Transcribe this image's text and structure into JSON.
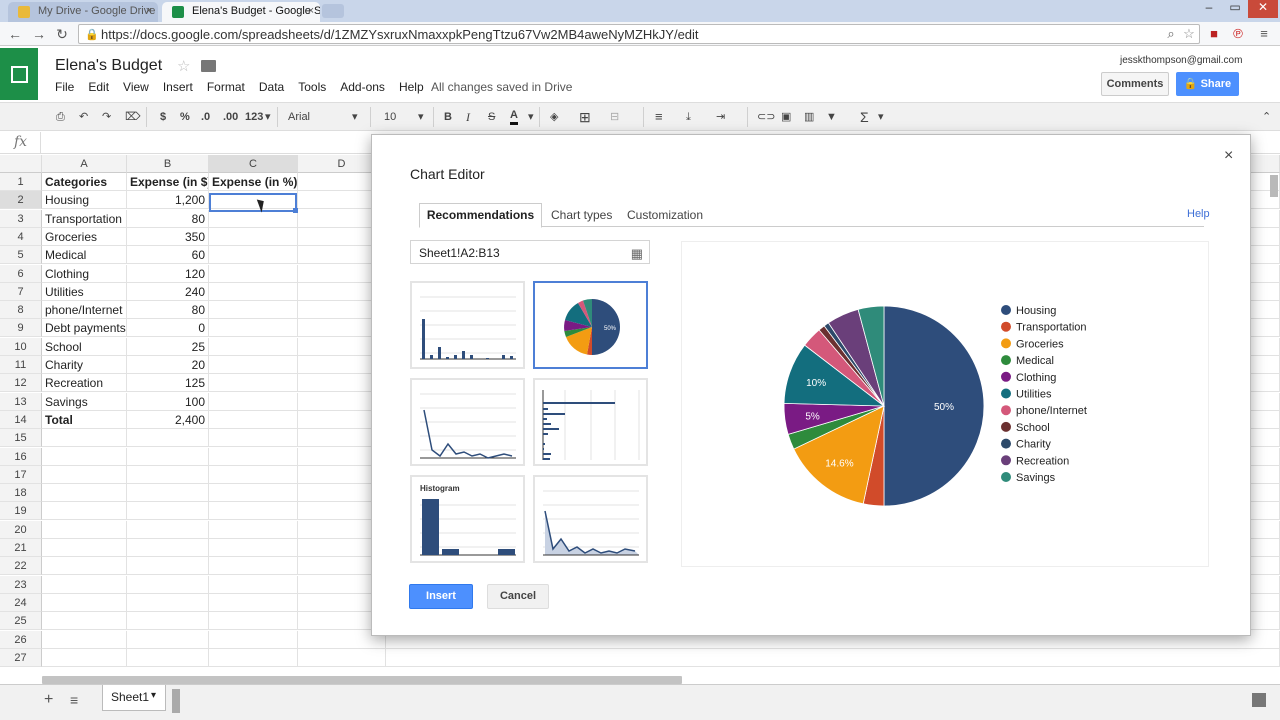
{
  "browser": {
    "tabs": [
      {
        "label": "My Drive - Google Drive",
        "active": false
      },
      {
        "label": "Elena's Budget - Google S",
        "active": true
      }
    ],
    "url": "https://docs.google.com/spreadsheets/d/1ZMZYsxruxNmaxxpkPengTtzu67Vw2MB4aweNyMZHkJY/edit"
  },
  "doc": {
    "title": "Elena's Budget",
    "menu": [
      "File",
      "Edit",
      "View",
      "Insert",
      "Format",
      "Data",
      "Tools",
      "Add-ons",
      "Help"
    ],
    "saved_status": "All changes saved in Drive",
    "user_email": "jesskthompson@gmail.com",
    "comments_label": "Comments",
    "share_label": "Share"
  },
  "toolbar": {
    "currency": "$",
    "percent": "%",
    "dec_less": ".0",
    "dec_more": ".00",
    "more_formats": "123",
    "font": "Arial",
    "font_size": "10",
    "bold": "B",
    "italic": "I",
    "strike": "S",
    "text_color": "A",
    "sum": "Σ"
  },
  "sheet": {
    "columns": [
      "A",
      "B",
      "C",
      "D"
    ],
    "rows": [
      "1",
      "2",
      "3",
      "4",
      "5",
      "6",
      "7",
      "8",
      "9",
      "10",
      "11",
      "12",
      "13",
      "14",
      "15",
      "16",
      "17",
      "18",
      "19",
      "20",
      "21",
      "22",
      "23",
      "24",
      "25",
      "26",
      "27"
    ],
    "header": [
      "Categories",
      "Expense (in $)",
      "Expense (in %)"
    ],
    "data": [
      [
        "Housing",
        "1,200"
      ],
      [
        "Transportation",
        "80"
      ],
      [
        "Groceries",
        "350"
      ],
      [
        "Medical",
        "60"
      ],
      [
        "Clothing",
        "120"
      ],
      [
        "Utilities",
        "240"
      ],
      [
        "phone/Internet",
        "80"
      ],
      [
        "Debt payments",
        "0"
      ],
      [
        "School",
        "25"
      ],
      [
        "Charity",
        "20"
      ],
      [
        "Recreation",
        "125"
      ],
      [
        "Savings",
        "100"
      ]
    ],
    "total_label": "Total",
    "total_value": "2,400",
    "sheet_tab": "Sheet1"
  },
  "chart_editor": {
    "title": "Chart Editor",
    "close": "×",
    "tabs": [
      "Recommendations",
      "Chart types",
      "Customization"
    ],
    "help": "Help",
    "range": "Sheet1!A2:B13",
    "histogram_label": "Histogram",
    "insert_label": "Insert",
    "cancel_label": "Cancel"
  },
  "chart_data": {
    "type": "pie",
    "labels": [
      "Housing",
      "Transportation",
      "Groceries",
      "Medical",
      "Clothing",
      "Utilities",
      "phone/Internet",
      "Debt payments",
      "School",
      "Charity",
      "Recreation",
      "Savings"
    ],
    "values": [
      1200,
      80,
      350,
      60,
      120,
      240,
      80,
      0,
      25,
      20,
      125,
      100
    ],
    "colors": [
      "#2e4d7b",
      "#d14b2a",
      "#f39c12",
      "#2e8b3c",
      "#7a1b84",
      "#136e7e",
      "#d4587a",
      "#6b3030",
      "#2d4a6a",
      "#6a3f7a",
      "#2f8b7a"
    ],
    "legend": [
      "Housing",
      "Transportation",
      "Groceries",
      "Medical",
      "Clothing",
      "Utilities",
      "phone/Internet",
      "School",
      "Charity",
      "Recreation",
      "Savings"
    ],
    "slice_labels": [
      {
        "label": "50%",
        "index": 0
      },
      {
        "label": "14.6%",
        "index": 2
      },
      {
        "label": "5%",
        "index": 4
      },
      {
        "label": "10%",
        "index": 5
      }
    ],
    "legend_position": "right"
  }
}
